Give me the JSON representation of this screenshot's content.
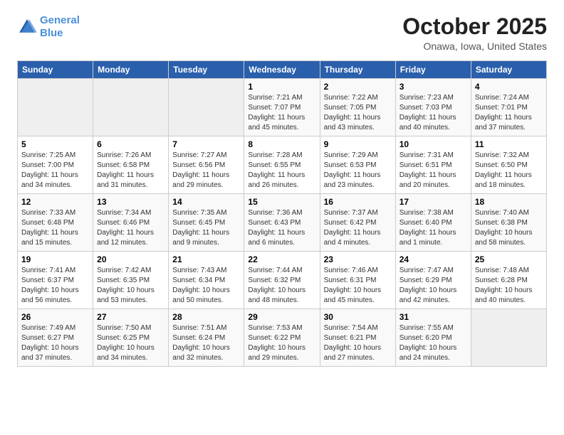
{
  "header": {
    "logo_line1": "General",
    "logo_line2": "Blue",
    "month": "October 2025",
    "location": "Onawa, Iowa, United States"
  },
  "weekdays": [
    "Sunday",
    "Monday",
    "Tuesday",
    "Wednesday",
    "Thursday",
    "Friday",
    "Saturday"
  ],
  "weeks": [
    [
      {
        "day": "",
        "info": ""
      },
      {
        "day": "",
        "info": ""
      },
      {
        "day": "",
        "info": ""
      },
      {
        "day": "1",
        "info": "Sunrise: 7:21 AM\nSunset: 7:07 PM\nDaylight: 11 hours and 45 minutes."
      },
      {
        "day": "2",
        "info": "Sunrise: 7:22 AM\nSunset: 7:05 PM\nDaylight: 11 hours and 43 minutes."
      },
      {
        "day": "3",
        "info": "Sunrise: 7:23 AM\nSunset: 7:03 PM\nDaylight: 11 hours and 40 minutes."
      },
      {
        "day": "4",
        "info": "Sunrise: 7:24 AM\nSunset: 7:01 PM\nDaylight: 11 hours and 37 minutes."
      }
    ],
    [
      {
        "day": "5",
        "info": "Sunrise: 7:25 AM\nSunset: 7:00 PM\nDaylight: 11 hours and 34 minutes."
      },
      {
        "day": "6",
        "info": "Sunrise: 7:26 AM\nSunset: 6:58 PM\nDaylight: 11 hours and 31 minutes."
      },
      {
        "day": "7",
        "info": "Sunrise: 7:27 AM\nSunset: 6:56 PM\nDaylight: 11 hours and 29 minutes."
      },
      {
        "day": "8",
        "info": "Sunrise: 7:28 AM\nSunset: 6:55 PM\nDaylight: 11 hours and 26 minutes."
      },
      {
        "day": "9",
        "info": "Sunrise: 7:29 AM\nSunset: 6:53 PM\nDaylight: 11 hours and 23 minutes."
      },
      {
        "day": "10",
        "info": "Sunrise: 7:31 AM\nSunset: 6:51 PM\nDaylight: 11 hours and 20 minutes."
      },
      {
        "day": "11",
        "info": "Sunrise: 7:32 AM\nSunset: 6:50 PM\nDaylight: 11 hours and 18 minutes."
      }
    ],
    [
      {
        "day": "12",
        "info": "Sunrise: 7:33 AM\nSunset: 6:48 PM\nDaylight: 11 hours and 15 minutes."
      },
      {
        "day": "13",
        "info": "Sunrise: 7:34 AM\nSunset: 6:46 PM\nDaylight: 11 hours and 12 minutes."
      },
      {
        "day": "14",
        "info": "Sunrise: 7:35 AM\nSunset: 6:45 PM\nDaylight: 11 hours and 9 minutes."
      },
      {
        "day": "15",
        "info": "Sunrise: 7:36 AM\nSunset: 6:43 PM\nDaylight: 11 hours and 6 minutes."
      },
      {
        "day": "16",
        "info": "Sunrise: 7:37 AM\nSunset: 6:42 PM\nDaylight: 11 hours and 4 minutes."
      },
      {
        "day": "17",
        "info": "Sunrise: 7:38 AM\nSunset: 6:40 PM\nDaylight: 11 hours and 1 minute."
      },
      {
        "day": "18",
        "info": "Sunrise: 7:40 AM\nSunset: 6:38 PM\nDaylight: 10 hours and 58 minutes."
      }
    ],
    [
      {
        "day": "19",
        "info": "Sunrise: 7:41 AM\nSunset: 6:37 PM\nDaylight: 10 hours and 56 minutes."
      },
      {
        "day": "20",
        "info": "Sunrise: 7:42 AM\nSunset: 6:35 PM\nDaylight: 10 hours and 53 minutes."
      },
      {
        "day": "21",
        "info": "Sunrise: 7:43 AM\nSunset: 6:34 PM\nDaylight: 10 hours and 50 minutes."
      },
      {
        "day": "22",
        "info": "Sunrise: 7:44 AM\nSunset: 6:32 PM\nDaylight: 10 hours and 48 minutes."
      },
      {
        "day": "23",
        "info": "Sunrise: 7:46 AM\nSunset: 6:31 PM\nDaylight: 10 hours and 45 minutes."
      },
      {
        "day": "24",
        "info": "Sunrise: 7:47 AM\nSunset: 6:29 PM\nDaylight: 10 hours and 42 minutes."
      },
      {
        "day": "25",
        "info": "Sunrise: 7:48 AM\nSunset: 6:28 PM\nDaylight: 10 hours and 40 minutes."
      }
    ],
    [
      {
        "day": "26",
        "info": "Sunrise: 7:49 AM\nSunset: 6:27 PM\nDaylight: 10 hours and 37 minutes."
      },
      {
        "day": "27",
        "info": "Sunrise: 7:50 AM\nSunset: 6:25 PM\nDaylight: 10 hours and 34 minutes."
      },
      {
        "day": "28",
        "info": "Sunrise: 7:51 AM\nSunset: 6:24 PM\nDaylight: 10 hours and 32 minutes."
      },
      {
        "day": "29",
        "info": "Sunrise: 7:53 AM\nSunset: 6:22 PM\nDaylight: 10 hours and 29 minutes."
      },
      {
        "day": "30",
        "info": "Sunrise: 7:54 AM\nSunset: 6:21 PM\nDaylight: 10 hours and 27 minutes."
      },
      {
        "day": "31",
        "info": "Sunrise: 7:55 AM\nSunset: 6:20 PM\nDaylight: 10 hours and 24 minutes."
      },
      {
        "day": "",
        "info": ""
      }
    ]
  ]
}
